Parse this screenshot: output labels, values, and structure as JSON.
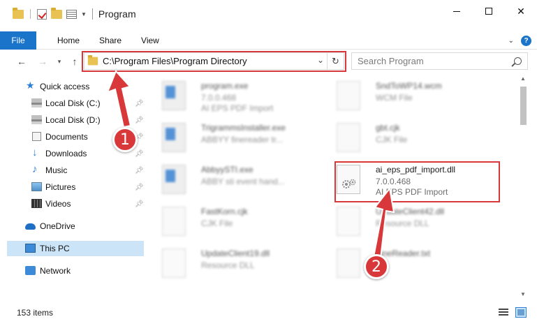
{
  "titlebar": {
    "title": "Program"
  },
  "ribbon": {
    "tabs": [
      "File",
      "Home",
      "Share",
      "View"
    ],
    "help": "?"
  },
  "address": {
    "path": "C:\\Program Files\\Program Directory",
    "search_placeholder": "Search Program"
  },
  "sidebar": {
    "items": [
      {
        "label": "Quick access",
        "icon": "star-icon"
      },
      {
        "label": "Local Disk (C:)",
        "icon": "disk-icon",
        "pinned": true
      },
      {
        "label": "Local Disk (D:)",
        "icon": "disk-icon",
        "pinned": true
      },
      {
        "label": "Documents",
        "icon": "documents-icon",
        "pinned": true
      },
      {
        "label": "Downloads",
        "icon": "download-icon",
        "pinned": true
      },
      {
        "label": "Music",
        "icon": "music-icon",
        "pinned": true
      },
      {
        "label": "Pictures",
        "icon": "pictures-icon",
        "pinned": true
      },
      {
        "label": "Videos",
        "icon": "videos-icon",
        "pinned": true
      },
      {
        "label": "OneDrive",
        "icon": "cloud-icon"
      },
      {
        "label": "This PC",
        "icon": "computer-icon",
        "selected": true
      },
      {
        "label": "Network",
        "icon": "network-icon"
      }
    ]
  },
  "files": [
    {
      "name": "program.exe",
      "line1": "7.0.0.468",
      "line2": "AI EPS PDF Import",
      "icon": "app-icon"
    },
    {
      "name": "SndToWP14.wcm",
      "line1": "WCM File",
      "line2": "",
      "icon": "document-icon"
    },
    {
      "name": "TrigrammsInstaller.exe",
      "line1": "ABBYY finereader tr...",
      "line2": "",
      "icon": "app-icon"
    },
    {
      "name": "gbt.cjk",
      "line1": "CJK File",
      "line2": "",
      "icon": "document-icon"
    },
    {
      "name": "AbbyySTI.exe",
      "line1": "ABBY sti event hand...",
      "line2": "",
      "icon": "app-icon"
    },
    {
      "name": "ai_eps_pdf_import.dll",
      "line1": "7.0.0.468",
      "line2": "AI EPS PDF Import",
      "icon": "dll-icon"
    },
    {
      "name": "FastKorn.cjk",
      "line1": "CJK File",
      "line2": "",
      "icon": "document-icon"
    },
    {
      "name": "UpdateClient42.dll",
      "line1": "Resource DLL",
      "line2": "",
      "icon": "dll-icon"
    },
    {
      "name": "UpdateClient19.dll",
      "line1": "Resource DLL",
      "line2": "",
      "icon": "dll-icon"
    },
    {
      "name": "FineReader.txt",
      "line1": "",
      "line2": "",
      "icon": "document-icon"
    }
  ],
  "status": {
    "item_count": "153 items"
  },
  "annotations": {
    "step1": "1",
    "step2": "2",
    "color": "#d9383a"
  },
  "colors": {
    "accent": "#1a74c9",
    "selection": "#cce4f7"
  }
}
